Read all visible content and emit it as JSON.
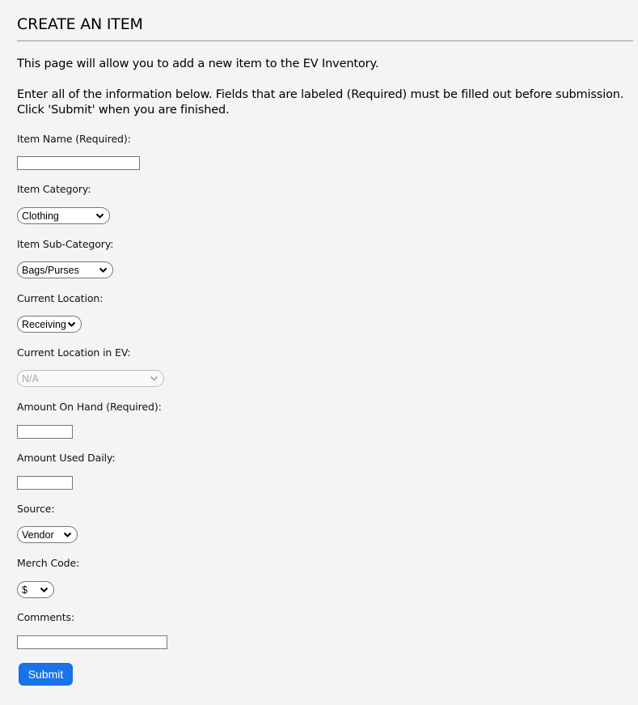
{
  "page": {
    "title": "CREATE AN ITEM",
    "intro_line1": "This page will allow you to add a new item to the EV Inventory.",
    "intro_line2": "Enter all of the information below. Fields that are labeled (Required) must be filled out before submission. Click 'Submit' when you are finished."
  },
  "form": {
    "item_name": {
      "label": "Item Name (Required):",
      "value": ""
    },
    "item_category": {
      "label": "Item Category:",
      "selected": "Clothing"
    },
    "item_subcategory": {
      "label": "Item Sub-Category:",
      "selected": "Bags/Purses"
    },
    "current_location": {
      "label": "Current Location:",
      "selected": "Receiving"
    },
    "current_location_ev": {
      "label": "Current Location in EV:",
      "selected": "N/A",
      "disabled": true
    },
    "amount_on_hand": {
      "label": "Amount On Hand (Required):",
      "value": ""
    },
    "amount_used_daily": {
      "label": "Amount Used Daily:",
      "value": ""
    },
    "source": {
      "label": "Source:",
      "selected": "Vendor"
    },
    "merch_code": {
      "label": "Merch Code:",
      "selected": "$"
    },
    "comments": {
      "label": "Comments:",
      "value": ""
    },
    "submit_label": "Submit"
  },
  "icons": {
    "dropdown": "chevron-down-icon"
  },
  "colors": {
    "background": "#f4f4f4",
    "submit_button": "#1a73e8",
    "rule": "#999999",
    "disabled_text": "#a9a9a9"
  }
}
